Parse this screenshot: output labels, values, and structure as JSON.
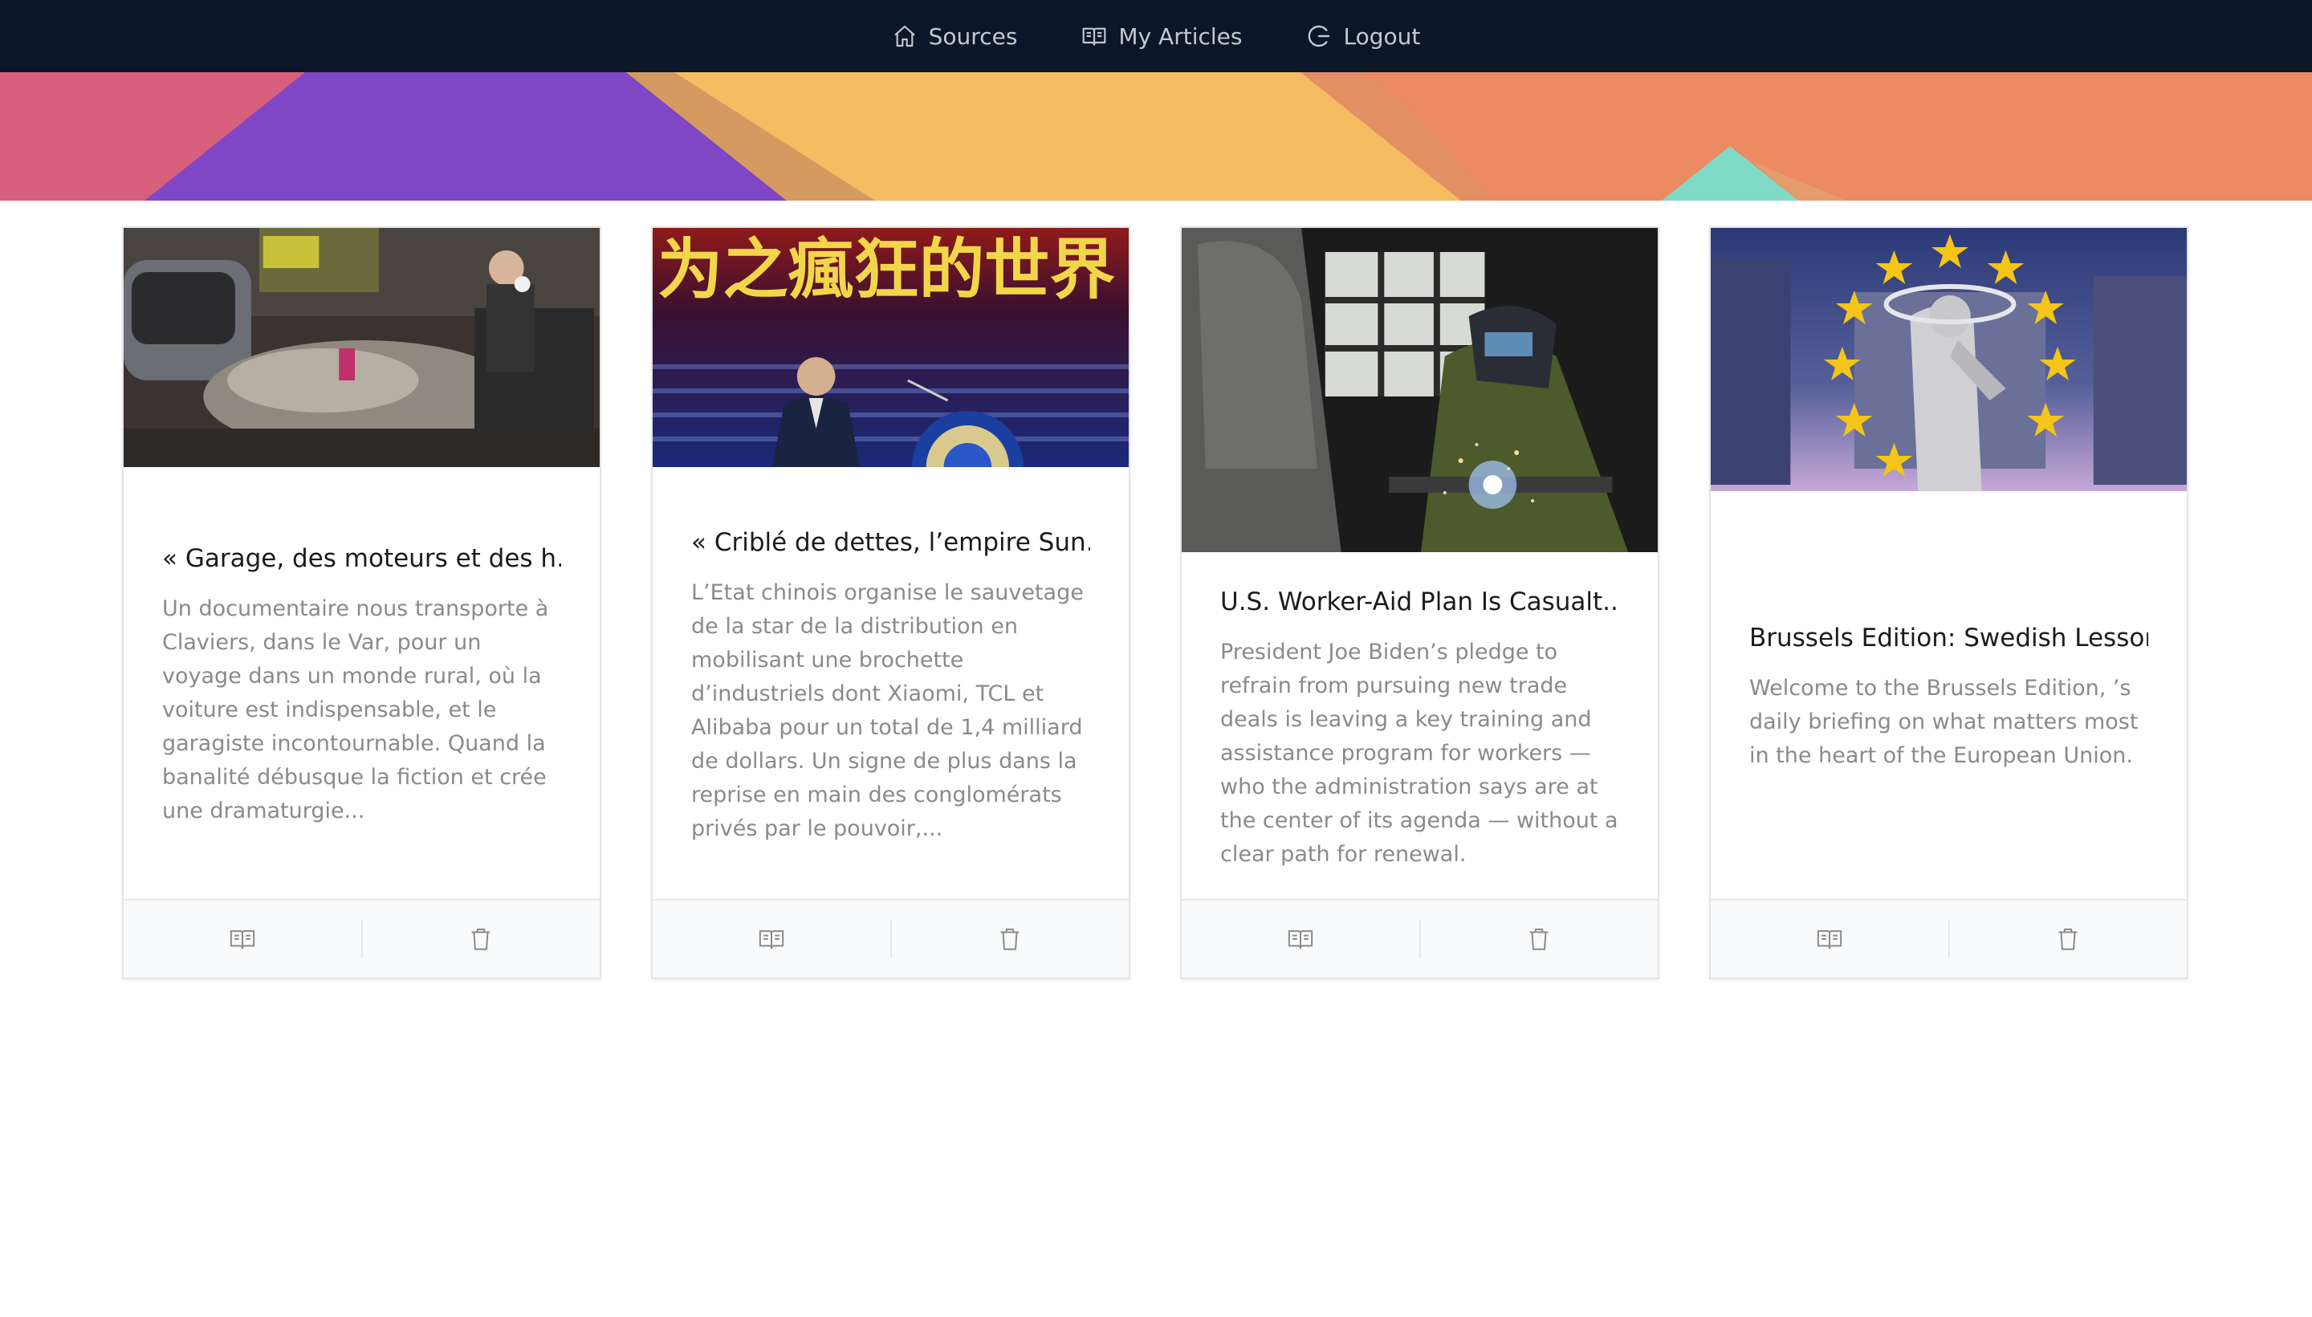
{
  "nav": {
    "items": [
      {
        "label": "Sources",
        "icon": "home-icon"
      },
      {
        "label": "My Articles",
        "icon": "book-open-icon"
      },
      {
        "label": "Logout",
        "icon": "logout-icon"
      }
    ]
  },
  "colors": {
    "navbar": "#0b1728",
    "banner_pink": "#d8607c",
    "banner_purple": "#7f46c6",
    "banner_yellow": "#f4bd62",
    "banner_orange": "#ec8a62",
    "banner_teal": "#7fdbc8"
  },
  "cards": [
    {
      "title": "« Garage, des moteurs et des h...",
      "description": "Un documentaire nous transporte à Claviers, dans le Var, pour un voyage dans un monde rural, où la voiture est indispensable, et le garagiste incontournable. Quand la banalité débusque la fiction et crée une dramaturgie...",
      "read_icon": "book-open-icon",
      "delete_icon": "trash-icon"
    },
    {
      "title": "« Criblé de dettes, l’empire Sun...",
      "description": "L’Etat chinois organise le sauvetage de la star de la distribution en mobilisant une brochette d’industriels dont Xiaomi, TCL et Alibaba pour un total de 1,4 milliard de dollars. Un signe de plus dans la reprise en main des conglomérats privés par le pouvoir,...",
      "image_text": "为之瘋狂的世界",
      "read_icon": "book-open-icon",
      "delete_icon": "trash-icon"
    },
    {
      "title": "U.S. Worker-Aid Plan Is Casualt...",
      "description": "President Joe Biden’s pledge to refrain from pursuing new trade deals is leaving a key training and assistance program for workers — who the administration says are at the center of its agenda — without a clear path for renewal.",
      "read_icon": "book-open-icon",
      "delete_icon": "trash-icon"
    },
    {
      "title": "Brussels Edition: Swedish Lesson",
      "description": "Welcome to the Brussels Edition, ’s daily briefing on what matters most in the heart of the European Union.",
      "read_icon": "book-open-icon",
      "delete_icon": "trash-icon"
    }
  ]
}
